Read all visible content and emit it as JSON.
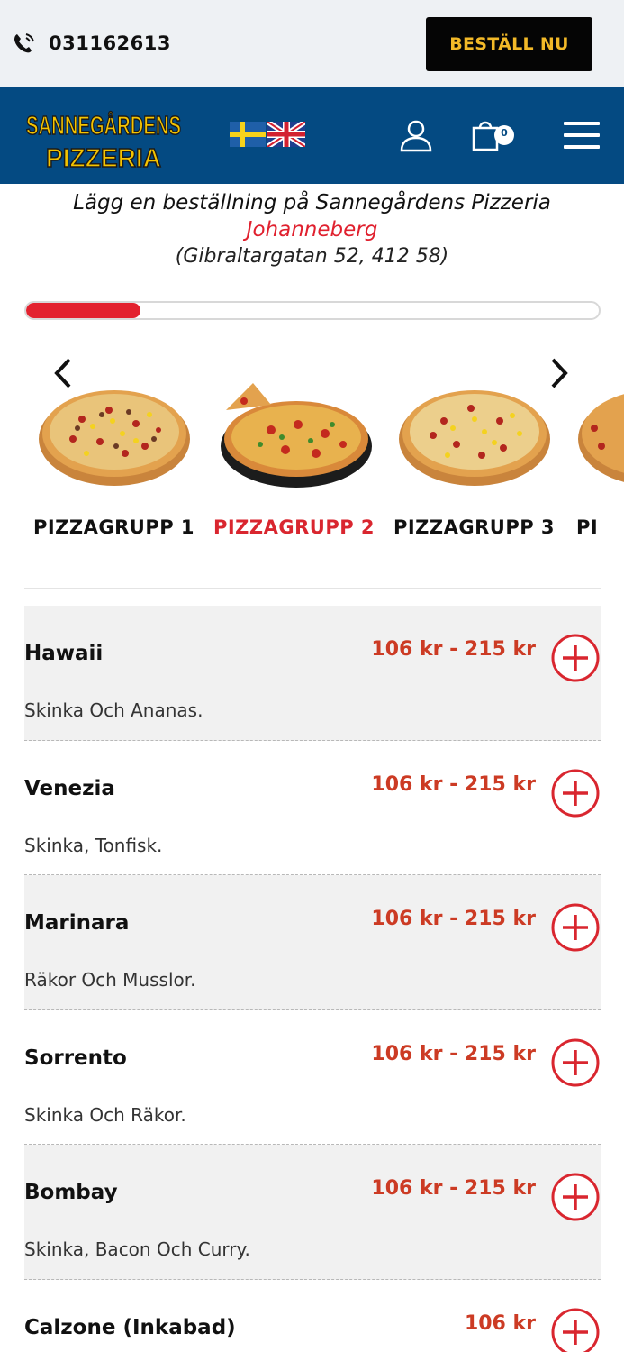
{
  "topbar": {
    "phone": "031162613",
    "order_button": "BESTÄLL NU"
  },
  "header": {
    "logo_line1": "SANNEGÅRDENS",
    "logo_line2": "PIZZERIA",
    "cart_count": "0"
  },
  "intro": {
    "title": "Lägg en beställning på Sannegårdens Pizzeria",
    "city": "Johanneberg",
    "address": "(Gibraltargatan 52, 412 58)"
  },
  "progress": {
    "value": 0.2
  },
  "categories": [
    {
      "label": "PIZZAGRUPP 1",
      "active": false
    },
    {
      "label": "PIZZAGRUPP 2",
      "active": true
    },
    {
      "label": "PIZZAGRUPP 3",
      "active": false
    },
    {
      "label": "PI",
      "active": false
    }
  ],
  "items": [
    {
      "name": "Hawaii",
      "price": "106 kr  - 215 kr",
      "desc": "Skinka Och Ananas."
    },
    {
      "name": "Venezia",
      "price": "106 kr  - 215 kr",
      "desc": "Skinka, Tonfisk."
    },
    {
      "name": "Marinara",
      "price": "106 kr  - 215 kr",
      "desc": "Räkor Och Musslor."
    },
    {
      "name": "Sorrento",
      "price": "106 kr  - 215 kr",
      "desc": "Skinka Och Räkor."
    },
    {
      "name": "Bombay",
      "price": "106 kr  - 215 kr",
      "desc": "Skinka, Bacon Och Curry."
    },
    {
      "name": "Calzone (Inkabad)",
      "price": "106 kr",
      "desc": ""
    }
  ],
  "colors": {
    "brand_blue": "#044a82",
    "accent_red": "#e3222f",
    "price_red": "#cc3b24",
    "button_gold": "#f2b928"
  }
}
